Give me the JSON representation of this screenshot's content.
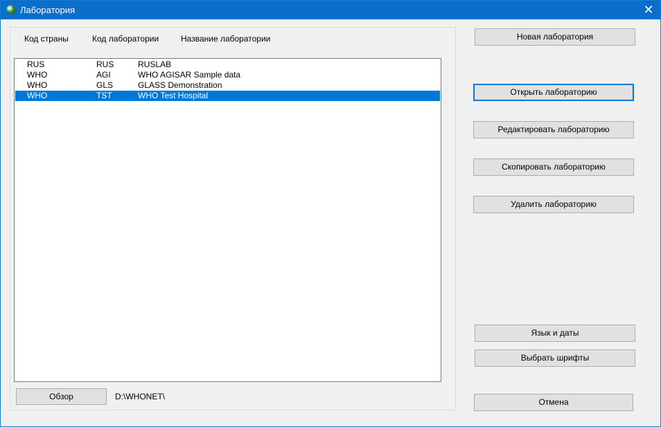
{
  "window": {
    "title": "Лаборатория",
    "close_glyph": "✕"
  },
  "columns": [
    "Код страны",
    "Код лаборатории",
    "Название лаборатории"
  ],
  "rows": [
    {
      "country": "RUS",
      "code": "RUS",
      "name": "RUSLAB",
      "selected": false
    },
    {
      "country": "WHO",
      "code": "AGI",
      "name": "WHO AGISAR Sample data",
      "selected": false
    },
    {
      "country": "WHO",
      "code": "GLS",
      "name": "GLASS Demonstration",
      "selected": false
    },
    {
      "country": "WHO",
      "code": "TST",
      "name": "WHO Test Hospital",
      "selected": true
    }
  ],
  "buttons": {
    "new": "Новая лаборатория",
    "open": "Открыть лабораторию",
    "edit": "Редактировать лабораторию",
    "copy": "Скопировать лабораторию",
    "delete": "Удалить лабораторию",
    "language": "Язык и даты",
    "fonts": "Выбрать шрифты",
    "cancel": "Отмена",
    "browse": "Обзор"
  },
  "path": "D:\\WHONET\\",
  "colors": {
    "titlebar": "#0a6ecc",
    "selection": "#0078d7"
  }
}
